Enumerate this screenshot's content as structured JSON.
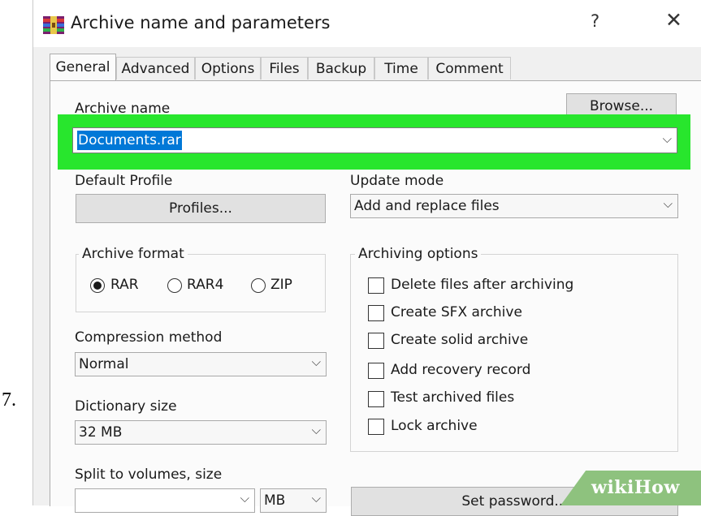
{
  "step_number": "7.",
  "window": {
    "title": "Archive name and parameters",
    "help_label": "?",
    "close_label": "✕"
  },
  "tabs": [
    {
      "label": "General",
      "active": true
    },
    {
      "label": "Advanced",
      "active": false
    },
    {
      "label": "Options",
      "active": false
    },
    {
      "label": "Files",
      "active": false
    },
    {
      "label": "Backup",
      "active": false
    },
    {
      "label": "Time",
      "active": false
    },
    {
      "label": "Comment",
      "active": false
    }
  ],
  "archive_name": {
    "label": "Archive name",
    "value": "Documents.rar",
    "browse_label": "Browse..."
  },
  "default_profile": {
    "label": "Default Profile",
    "button_label": "Profiles..."
  },
  "update_mode": {
    "label": "Update mode",
    "value": "Add and replace files"
  },
  "archive_format": {
    "label": "Archive format",
    "options": [
      {
        "label": "RAR",
        "checked": true
      },
      {
        "label": "RAR4",
        "checked": false
      },
      {
        "label": "ZIP",
        "checked": false
      }
    ]
  },
  "compression_method": {
    "label": "Compression method",
    "value": "Normal"
  },
  "dictionary_size": {
    "label": "Dictionary size",
    "value": "32 MB"
  },
  "split_volumes": {
    "label": "Split to volumes, size",
    "value": "",
    "unit": "MB"
  },
  "archiving_options": {
    "label": "Archiving options",
    "items": [
      {
        "label": "Delete files after archiving",
        "checked": false
      },
      {
        "label": "Create SFX archive",
        "checked": false
      },
      {
        "label": "Create solid archive",
        "checked": false
      },
      {
        "label": "Add recovery record",
        "checked": false
      },
      {
        "label": "Test archived files",
        "checked": false
      },
      {
        "label": "Lock archive",
        "checked": false
      }
    ]
  },
  "set_password_label": "Set password...",
  "watermark": "wikiHow",
  "colors": {
    "highlight": "#28e62d",
    "selection": "#0078d7",
    "watermark": "#8ec27e"
  },
  "icons": [
    "winrar-app-icon",
    "chevron-down-icon",
    "close-icon",
    "help-icon"
  ]
}
